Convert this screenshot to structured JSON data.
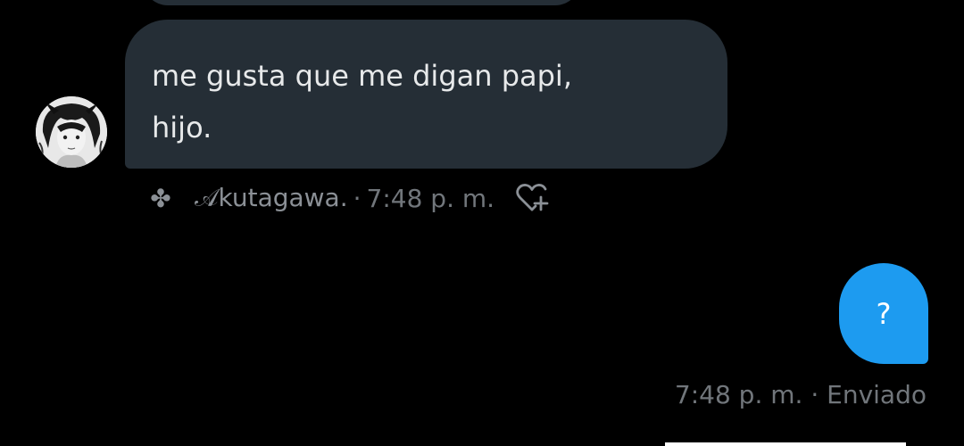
{
  "colors": {
    "background": "#000000",
    "received_bubble": "#252e36",
    "sent_bubble": "#1d9bf0",
    "meta_text": "#71767b",
    "message_text": "#e7e9ea"
  },
  "received_message": {
    "lines": [
      "me gusta que me digan papi,",
      "hijo."
    ],
    "reaction_emoji": "✤",
    "sender": "𝒜kutagawa.",
    "separator": "·",
    "time": "7:48 p. m.",
    "like_icon": "heart-plus-icon",
    "avatar_icon": "user-avatar"
  },
  "sent_message": {
    "text": "?",
    "time": "7:48 p. m.",
    "separator": "·",
    "status": "Enviado"
  }
}
